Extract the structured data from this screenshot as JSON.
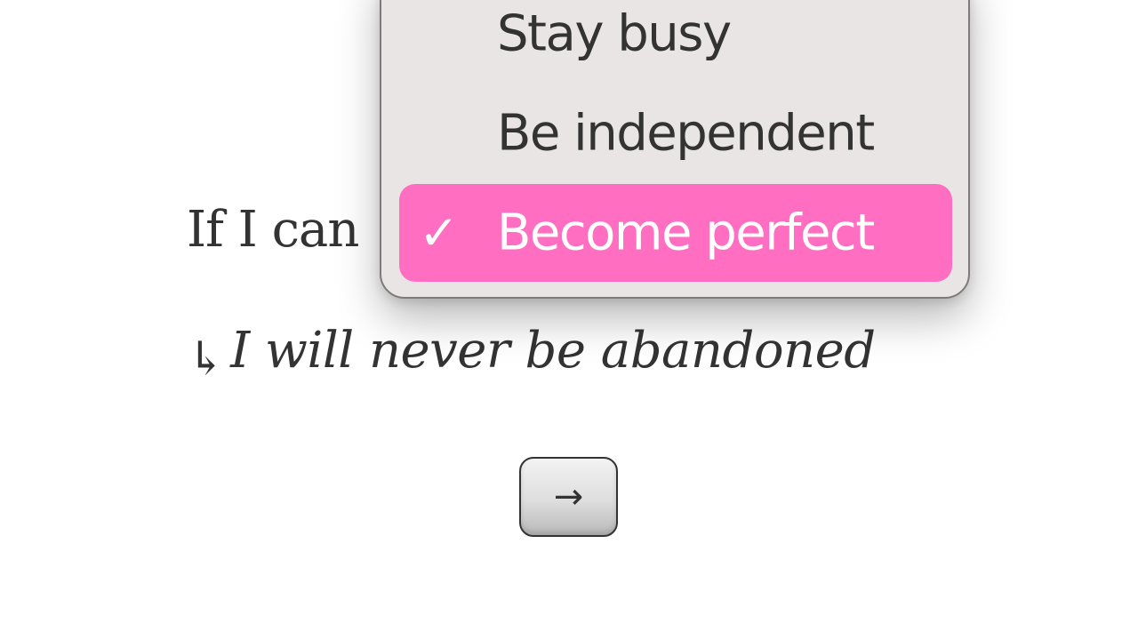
{
  "sentence": {
    "premise": "If I can",
    "consequence_arrow": "↳",
    "consequence": "I will never be abandoned"
  },
  "dropdown": {
    "options": [
      {
        "label": "Stay busy",
        "selected": false
      },
      {
        "label": "Be independent",
        "selected": false
      },
      {
        "label": "Become perfect",
        "selected": true
      }
    ],
    "check_glyph": "✓",
    "selected_color": "#ff6ec1",
    "background_color": "#eae5e5"
  },
  "next_button": {
    "label": "→"
  }
}
